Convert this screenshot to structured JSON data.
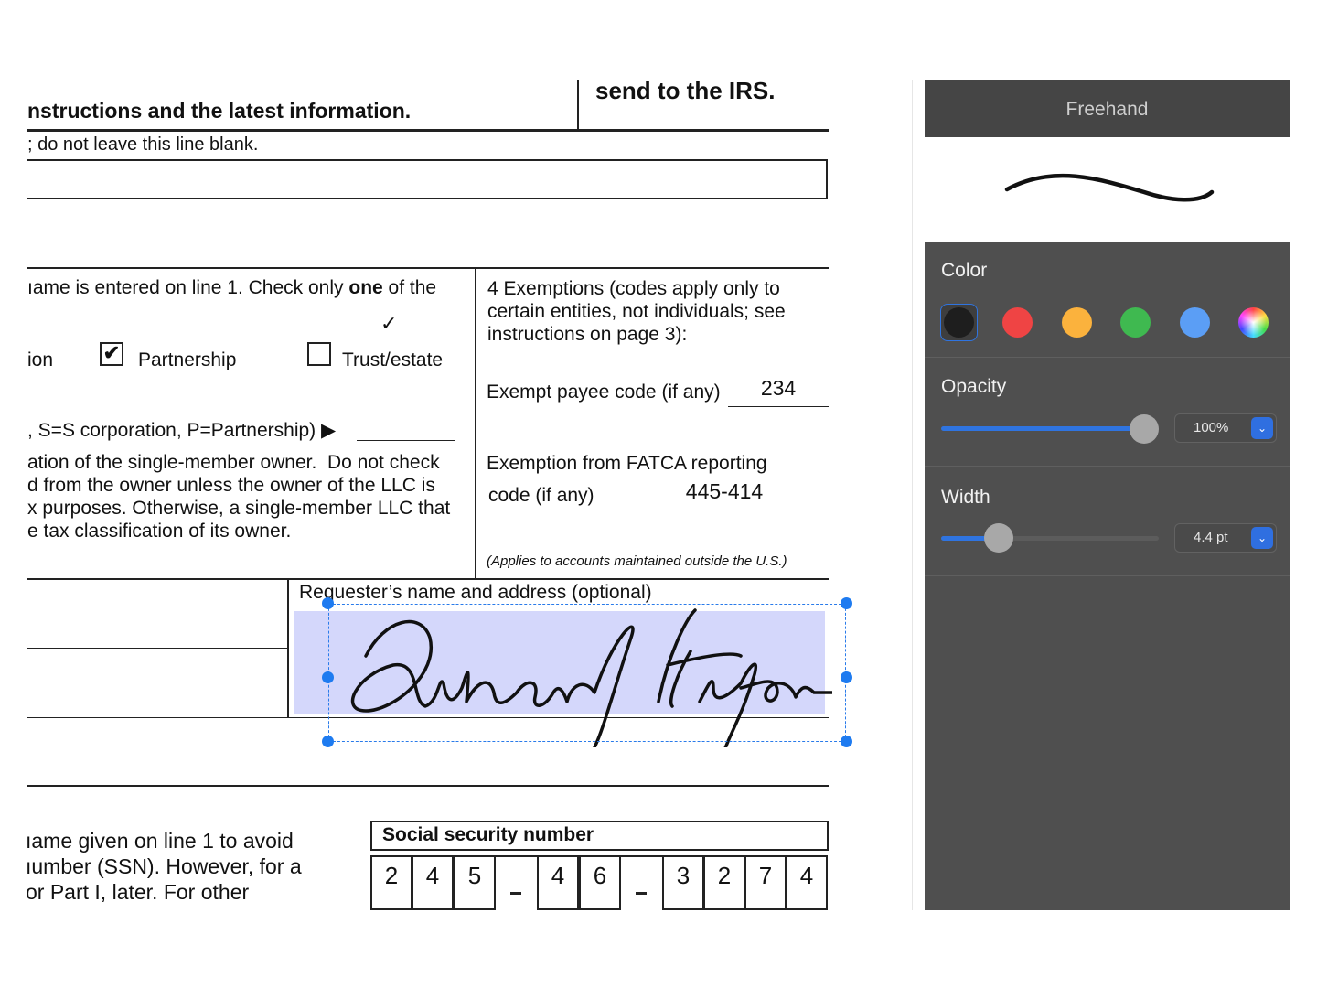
{
  "document": {
    "line_instructions": "nstructions and the latest information.",
    "send_irs": "send to the IRS.",
    "line_blank": "; do not leave this line blank.",
    "check_only": [
      "ıame is entered on line 1. Check only ",
      "one",
      " of the"
    ],
    "ion": "ion",
    "partnership": "Partnership",
    "partnership_checked": true,
    "trust": "Trust/estate",
    "trust_checked": false,
    "sscorp": ", S=S corporation, P=Partnership) ▶",
    "llc_lines": [
      "ation of the single-member owner.  Do not check",
      "d from the owner unless the owner of the LLC is",
      "x purposes. Otherwise, a single-member LLC that",
      "e tax classification of its owner."
    ],
    "exemptions": [
      "4  Exemptions (codes apply only to",
      "certain entities, not individuals; see",
      "instructions on page 3):"
    ],
    "exempt_payee_label": "Exempt payee code (if any)",
    "exempt_payee_value": "234",
    "fatca_label_1": "Exemption from FATCA reporting",
    "fatca_label_2": "code (if any)",
    "fatca_value": "445-414",
    "applies": "(Applies to accounts maintained outside the U.S.)",
    "requester": "Requester’s name and address (optional)",
    "name_lines": [
      "ıame given on line 1 to avoid",
      "ıumber (SSN). However, for a",
      "or Part I, later. For other"
    ],
    "ssn_label": "Social security number",
    "ssn_digits": [
      "2",
      "4",
      "5",
      "4",
      "6",
      "3",
      "2",
      "7",
      "4"
    ],
    "signature_highlight": "#d4d7fb"
  },
  "panel": {
    "title": "Freehand",
    "color_label": "Color",
    "colors": [
      "#1e1e1e",
      "#ef4444",
      "#fbb23d",
      "#3fb950",
      "#5b9ef5",
      "multicolor"
    ],
    "selected_color": "#1e1e1e",
    "opacity_label": "Opacity",
    "opacity_value": "100%",
    "opacity_fraction": 1.0,
    "width_label": "Width",
    "width_value": "4.4 pt",
    "accent": "#2f74e0"
  }
}
